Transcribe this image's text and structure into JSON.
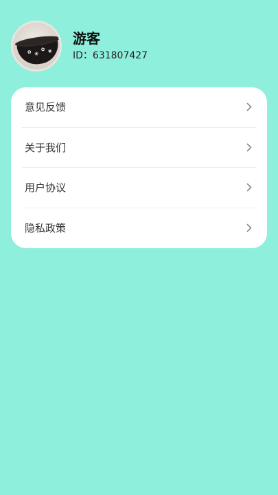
{
  "profile": {
    "name": "游客",
    "id_text": "ID：631807427"
  },
  "menu": {
    "items": [
      {
        "label": "意见反馈",
        "icon": "chevron-right-icon"
      },
      {
        "label": "关于我们",
        "icon": "chevron-right-icon"
      },
      {
        "label": "用户协议",
        "icon": "chevron-right-icon"
      },
      {
        "label": "隐私政策",
        "icon": "chevron-right-icon"
      }
    ]
  },
  "colors": {
    "background": "#8ef0dc",
    "card": "#ffffff",
    "chevron": "#8a8a8a"
  }
}
